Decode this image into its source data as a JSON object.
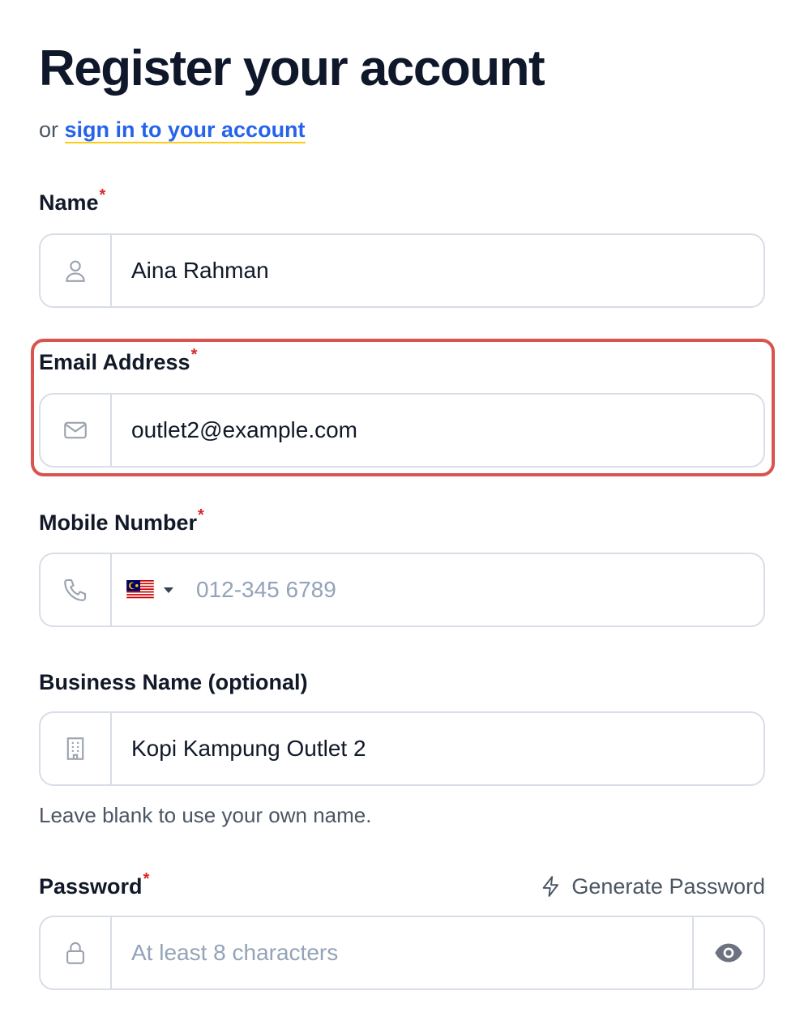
{
  "header": {
    "title": "Register your account",
    "subtitle_prefix": "or",
    "signin_link": "sign in to your account"
  },
  "form": {
    "name": {
      "label": "Name",
      "required_mark": "*",
      "value": "Aina Rahman",
      "icon": "user-icon"
    },
    "email": {
      "label": "Email Address",
      "required_mark": "*",
      "value": "outlet2@example.com",
      "icon": "mail-icon"
    },
    "mobile": {
      "label": "Mobile Number",
      "required_mark": "*",
      "placeholder": "012-345 6789",
      "icon": "phone-icon",
      "country_flag": "malaysia-flag-icon"
    },
    "business": {
      "label": "Business Name (optional)",
      "value": "Kopi Kampung Outlet 2",
      "hint": "Leave blank to use your own name.",
      "icon": "building-icon"
    },
    "password": {
      "label": "Password",
      "required_mark": "*",
      "placeholder": "At least 8 characters",
      "icon": "lock-icon",
      "generate_label": "Generate Password",
      "toggle_icon": "eye-icon"
    }
  },
  "colors": {
    "link": "#2563eb",
    "link_underline": "#facc15",
    "required": "#dc2626",
    "highlight_border": "#d9534f"
  }
}
